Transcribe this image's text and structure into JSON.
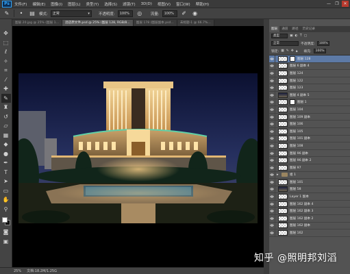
{
  "app": {
    "logo": "Ps"
  },
  "menu": [
    "文件(F)",
    "编辑(E)",
    "图像(I)",
    "图层(L)",
    "类型(Y)",
    "选择(S)",
    "滤镜(T)",
    "3D(D)",
    "视图(V)",
    "窗口(W)",
    "帮助(H)"
  ],
  "window_controls": {
    "minimize": "—",
    "restore": "❐",
    "close": "✕"
  },
  "options": {
    "mode_label": "模式:",
    "mode_value": "正常",
    "opacity_label": "不透明度:",
    "opacity_value": "100%",
    "flow_label": "流量:",
    "flow_value": "100%"
  },
  "doc_tabs": [
    "图层 20.jpg @ 25% (图层 1...",
    "酒店原文件.psd @ 25% (图层 128, RGB/8...",
    "图层 178 (图层副本.psd...",
    "未标题-1 @ 66.7%..."
  ],
  "status": {
    "zoom": "25%",
    "doc": "文档:18.2M/1.25G"
  },
  "panel": {
    "tabs": [
      "图层",
      "通道",
      "路径",
      "历史记录"
    ],
    "kind_label": "类型",
    "blend_mode": "正常",
    "opacity_label": "不透明度:",
    "opacity_value": "100%",
    "lock_label": "锁定:",
    "fill_label": "填充:",
    "fill_value": "100%"
  },
  "layers": [
    {
      "name": "图层 128",
      "thumb": "checker",
      "mask": true,
      "selected": true,
      "visible": true
    },
    {
      "name": "图层 6 副本 4",
      "thumb": "checker",
      "visible": true
    },
    {
      "name": "图层 124",
      "thumb": "checker",
      "visible": true
    },
    {
      "name": "图层 122",
      "thumb": "checker",
      "visible": true
    },
    {
      "name": "图层 123",
      "thumb": "checker",
      "visible": true
    },
    {
      "name": "图层 4 副本 5",
      "thumb": "image",
      "visible": true
    },
    {
      "name": "图层 1",
      "thumb": "checker",
      "mask": true,
      "visible": true
    },
    {
      "name": "图层 104",
      "thumb": "checker",
      "visible": true
    },
    {
      "name": "图层 109 副本",
      "thumb": "checker",
      "visible": true
    },
    {
      "name": "图层 106",
      "thumb": "checker",
      "visible": true
    },
    {
      "name": "图层 105",
      "thumb": "checker",
      "visible": true
    },
    {
      "name": "图层 101 副本",
      "thumb": "checker",
      "visible": true
    },
    {
      "name": "图层 108",
      "thumb": "checker",
      "visible": true
    },
    {
      "name": "图层 96 副本",
      "thumb": "checker",
      "visible": true
    },
    {
      "name": "图层 96 副本 2",
      "thumb": "checker",
      "visible": true
    },
    {
      "name": "图层 97",
      "thumb": "checker",
      "visible": true
    },
    {
      "name": "组 1",
      "thumb": "folder",
      "visible": true
    },
    {
      "name": "图层 101",
      "thumb": "checker",
      "visible": true
    },
    {
      "name": "图层 58",
      "thumb": "image",
      "visible": true
    },
    {
      "name": "Layer 1 副本",
      "thumb": "checker",
      "visible": true
    },
    {
      "name": "图层 162 副本 4",
      "thumb": "checker",
      "visible": true
    },
    {
      "name": "图层 162 副本 3",
      "thumb": "checker",
      "visible": true
    },
    {
      "name": "图层 162 副本 2",
      "thumb": "checker",
      "visible": true
    },
    {
      "name": "图层 162 副本",
      "thumb": "checker",
      "visible": true
    },
    {
      "name": "图层 162",
      "thumb": "checker",
      "visible": true
    }
  ],
  "watermark": "知乎 @照明邦刘滔"
}
